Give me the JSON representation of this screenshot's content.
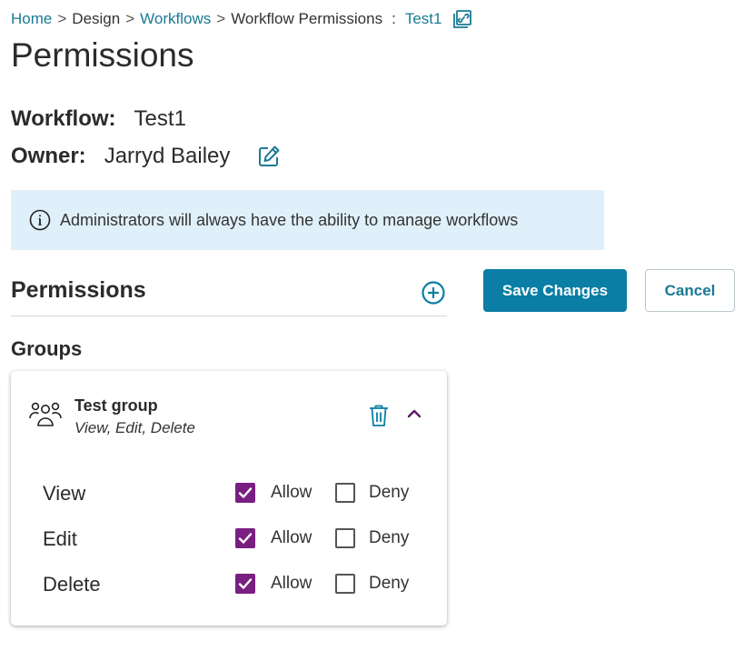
{
  "breadcrumb": {
    "items": [
      {
        "label": "Home",
        "link": true
      },
      {
        "label": "Design",
        "link": false
      },
      {
        "label": "Workflows",
        "link": true
      },
      {
        "label": "Workflow Permissions",
        "link": false
      }
    ],
    "separator": ">",
    "colon": ":",
    "current": "Test1",
    "icon": "copy-link-icon"
  },
  "page": {
    "title": "Permissions"
  },
  "workflow": {
    "label": "Workflow:",
    "value": "Test1"
  },
  "owner": {
    "label": "Owner:",
    "value": "Jarryd Bailey",
    "edit_icon": "edit-icon"
  },
  "info": {
    "icon": "info-icon",
    "text": "Administrators will always have the ability to manage workflows"
  },
  "permissions": {
    "title": "Permissions",
    "add_icon": "plus-circle-icon"
  },
  "actions": {
    "save_label": "Save Changes",
    "cancel_label": "Cancel"
  },
  "groups": {
    "title": "Groups",
    "items": [
      {
        "name": "Test group",
        "summary": "View, Edit, Delete",
        "icon": "group-icon",
        "permissions": [
          {
            "name": "View",
            "allow_label": "Allow",
            "deny_label": "Deny",
            "allow": true,
            "deny": false
          },
          {
            "name": "Edit",
            "allow_label": "Allow",
            "deny_label": "Deny",
            "allow": true,
            "deny": false
          },
          {
            "name": "Delete",
            "allow_label": "Allow",
            "deny_label": "Deny",
            "allow": true,
            "deny": false
          }
        ]
      }
    ]
  },
  "colors": {
    "link": "#1a7a94",
    "primary": "#0a7ea4",
    "checkbox": "#7a1f82",
    "info_bg": "#e0f0fa"
  }
}
